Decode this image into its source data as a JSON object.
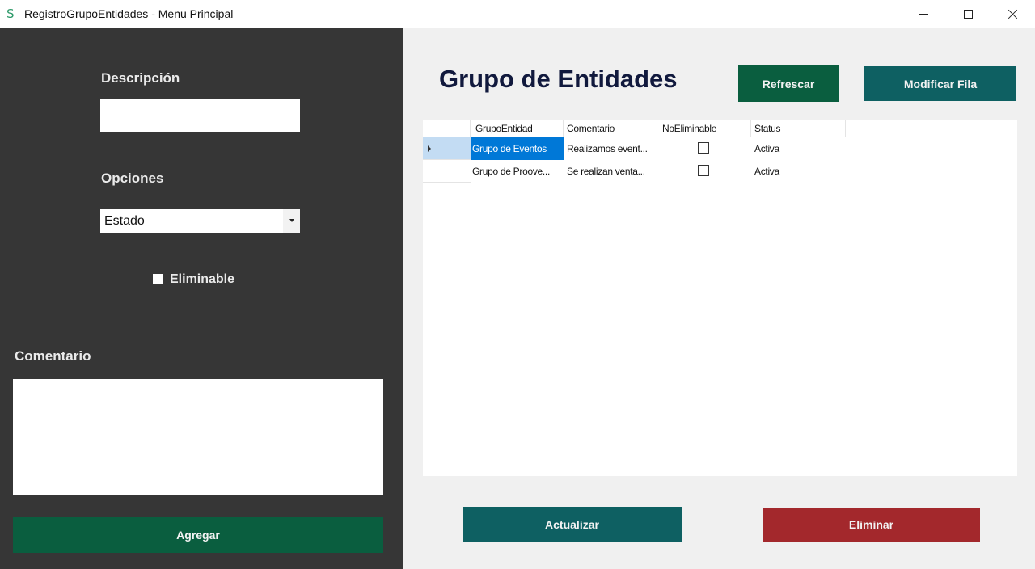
{
  "window": {
    "title": "RegistroGrupoEntidades - Menu Principal",
    "icon": "S"
  },
  "left": {
    "descripcion_label": "Descripción",
    "descripcion_value": "",
    "opciones_label": "Opciones",
    "opciones_selected": "Estado",
    "eliminable_label": "Eliminable",
    "eliminable_checked": false,
    "comentario_label": "Comentario",
    "comentario_value": "",
    "agregar_label": "Agregar"
  },
  "main": {
    "title": "Grupo de Entidades",
    "refrescar_label": "Refrescar",
    "modificar_label": "Modificar Fila",
    "actualizar_label": "Actualizar",
    "eliminar_label": "Eliminar"
  },
  "grid": {
    "columns": [
      "GrupoEntidad",
      "Comentario",
      "NoEliminable",
      "Status"
    ],
    "rows": [
      {
        "grupo": "Grupo de Eventos",
        "comentario": "Realizamos event...",
        "no_eliminable": false,
        "status": "Activa",
        "selected": true
      },
      {
        "grupo": "Grupo de Proove...",
        "comentario": "Se realizan venta...",
        "no_eliminable": false,
        "status": "Activa",
        "selected": false
      }
    ]
  },
  "colors": {
    "left_panel": "#363636",
    "green_button": "#0a5e3f",
    "teal_button": "#0e6062",
    "red_button": "#a3282c",
    "selection": "#0078d7",
    "title": "#11193d"
  }
}
